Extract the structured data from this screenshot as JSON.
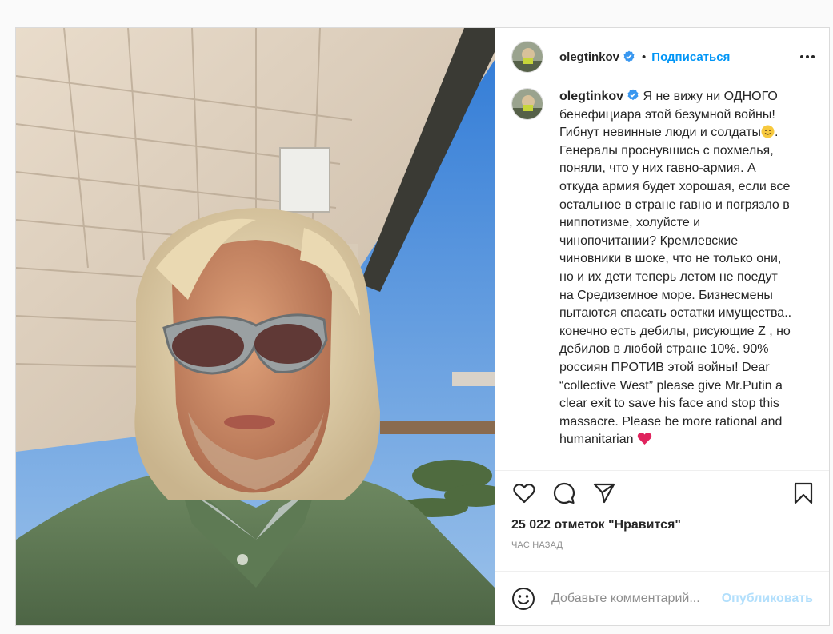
{
  "post": {
    "author": "olegtinkov",
    "separator": "•",
    "follow_label": "Подписаться",
    "caption_user": "olegtinkov",
    "caption_part1": "Я не вижу ни ОДНОГО\nбенефициара этой безумной войны!\nГибнут невинные люди и солдаты",
    "caption_part2": ".\nГенералы проснувшись с похмелья,\nпоняли, что у них гавно-армия. А\nоткуда армия будет хорошая, если все\nостальное в стране гавно и погрязло в\nниппотизме, холуйсте и\nчинопочитании? Кремлевские\nчиновники в шоке, что не только они,\nно и их дети теперь летом не поедут\nна Средиземное море. Бизнесмены\nпытаются спасать остатки имущества..\nконечно есть дебилы, рисующие Z , но\nдебилов в любой стране 10%. 90%\nроссиян ПРОТИВ этой войны! Dear\n“collective West” please give Mr.Putin a\nclear exit to save his face and stop this\nmassacre. Please be more rational and\nhumanitarian ",
    "likes": "25 022 отметок \"Нравится\"",
    "time_ago": "ЧАС НАЗАД",
    "comment_placeholder": "Добавьте комментарий...",
    "publish_label": "Опубликовать"
  },
  "icons": {
    "verified": "verified-badge-icon",
    "like": "heart-icon",
    "comment": "comment-bubble-icon",
    "share": "paper-plane-icon",
    "save": "bookmark-icon",
    "emoji": "smiley-icon",
    "more": "ellipsis-icon"
  },
  "colors": {
    "accent": "#0095f6",
    "publish_disabled": "#b2dffc",
    "verified": "#3897f0",
    "heart": "#e0245e"
  }
}
